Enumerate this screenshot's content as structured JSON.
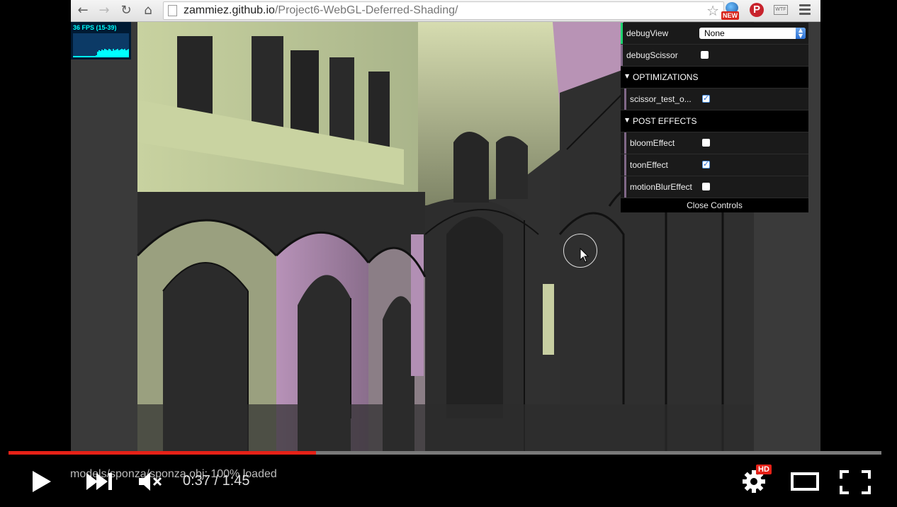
{
  "browser": {
    "url_host": "zammiez.github.io",
    "url_path": "/Project6-WebGL-Deferred-Shading/",
    "icons": [
      "back-icon",
      "forward-icon",
      "reload-icon",
      "home-icon",
      "page-icon",
      "star-icon",
      "new-extension-icon",
      "pinterest-icon",
      "wtf-extension-icon",
      "menu-icon"
    ],
    "ext_new_label": "NEW",
    "ext_pinterest_letter": "P",
    "ext_wtf_label": "WTF"
  },
  "stats": {
    "fps_text": "36 FPS (15-39)"
  },
  "gui": {
    "rows": [
      {
        "label": "debugView",
        "type": "select",
        "value": "None"
      },
      {
        "label": "debugScissor",
        "type": "checkbox",
        "checked": false
      }
    ],
    "folders": [
      {
        "title": "OPTIMIZATIONS",
        "items": [
          {
            "label": "scissor_test_o...",
            "checked": true
          }
        ]
      },
      {
        "title": "POST EFFECTS",
        "items": [
          {
            "label": "bloomEffect",
            "checked": false
          },
          {
            "label": "toonEffect",
            "checked": true
          },
          {
            "label": "motionBlurEffect",
            "checked": false
          }
        ]
      }
    ],
    "close_label": "Close Controls"
  },
  "video": {
    "status_text": "models/sponza/sponza.obj: 100% loaded",
    "current_time": "0:37",
    "separator": " / ",
    "duration": "1:45",
    "progress_fraction": 0.352,
    "hd_label": "HD",
    "progress_color": "#e62117",
    "icons": [
      "play-icon",
      "next-icon",
      "mute-icon",
      "settings-gear-icon",
      "theater-mode-icon",
      "fullscreen-icon"
    ]
  }
}
